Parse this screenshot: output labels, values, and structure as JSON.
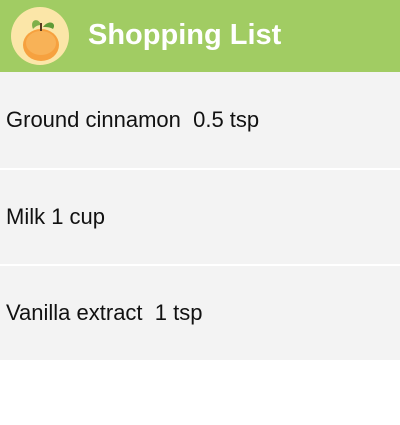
{
  "app_bar": {
    "icon": "orange-fruit-icon",
    "title": "Shopping List",
    "background_color": "#a1cc63"
  },
  "items": [
    {
      "label": "Ground cinnamon  0.5 tsp"
    },
    {
      "label": "Milk 1 cup"
    },
    {
      "label": "Vanilla extract  1 tsp"
    }
  ]
}
